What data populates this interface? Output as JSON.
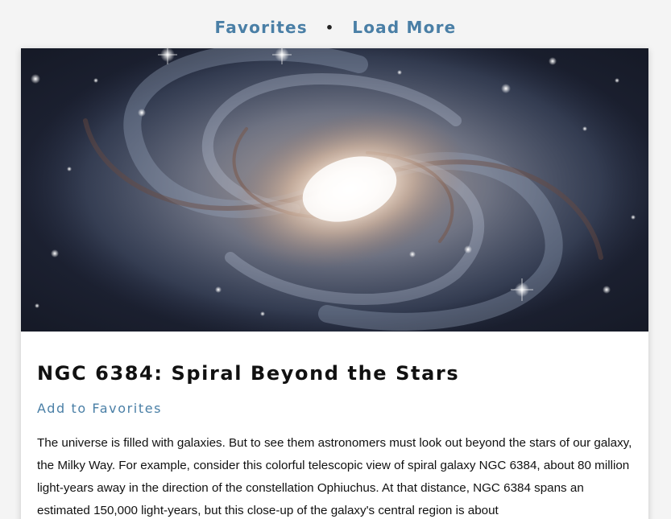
{
  "nav": {
    "favorites_label": "Favorites",
    "separator": "•",
    "load_more_label": "Load More"
  },
  "post": {
    "title": "NGC 6384: Spiral Beyond the Stars",
    "add_favorite_label": "Add to Favorites",
    "description": "The universe is filled with galaxies. But to see them astronomers must look out beyond the stars of our galaxy, the Milky Way. For example, consider this colorful telescopic view of spiral galaxy NGC 6384, about 80 million light-years away in the direction of the constellation Ophiuchus. At that distance, NGC 6384 spans an estimated 150,000 light-years, but this close-up of the galaxy's central region is about"
  },
  "colors": {
    "accent": "#4a7fa6",
    "background": "#f4f4f4",
    "card": "#ffffff",
    "text": "#111111"
  }
}
